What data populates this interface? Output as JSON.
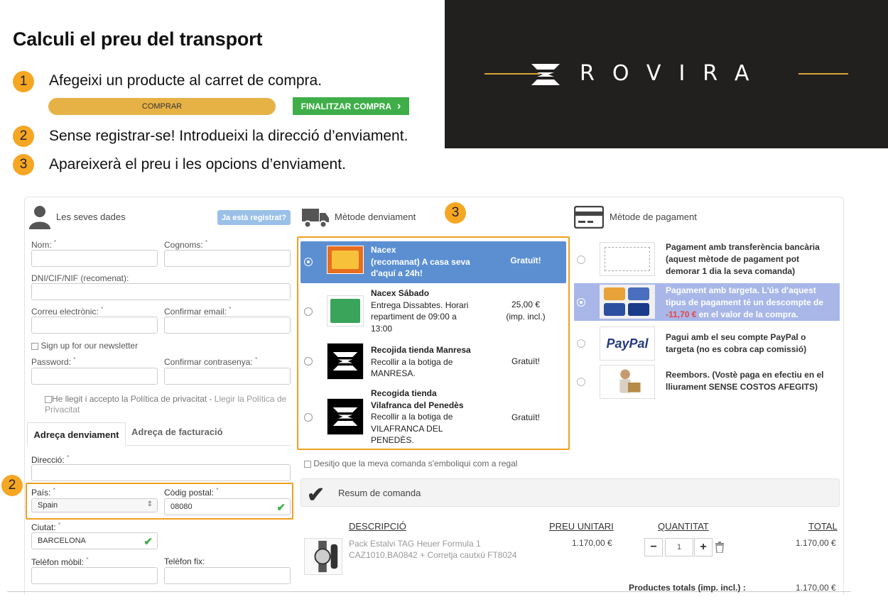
{
  "title": "Calculi el preu del transport",
  "steps": [
    {
      "num": "1",
      "text": "Afegeixi un producte al carret de compra."
    },
    {
      "num": "2",
      "text": "Sense registrar-se! Introdueixi la direcció d’enviament."
    },
    {
      "num": "3",
      "text": "Apareixerà el preu i les opcions d’enviament."
    }
  ],
  "buttons": {
    "comprar": "COMPRAR",
    "finalitzar": "FINALITZAR COMPRA",
    "finalitzar_icon": "›"
  },
  "brand": {
    "name": "ROVIRA",
    "accent_color": "#d7a534"
  },
  "annotations": {
    "box2": "2",
    "box3": "3"
  },
  "personal": {
    "header": "Les seves dades",
    "registered_button": "Ja està registrat?",
    "nom_label": "Nom:",
    "cognoms_label": "Cognoms:",
    "dni_label": "DNI/CIF/NIF (recomenat):",
    "email_label": "Correu electrònic:",
    "confirm_email_label": "Confirmar email:",
    "newsletter_label": "Sign up for our newsletter",
    "password_label": "Password:",
    "confirm_password_label": "Confirmar contrasenya:",
    "privacy_text": "He llegit i accepto la Política de privacitat - ",
    "privacy_link": "Llegir la Política de Privacitat",
    "required_mark": "*"
  },
  "address": {
    "tab_shipping": "Adreça denviament",
    "tab_billing": "Adreça de facturació",
    "direccio_label": "Direcció:",
    "pais_label": "País:",
    "pais_value": "Spain",
    "cp_label": "Còdig postal:",
    "cp_value": "08080",
    "ciutat_label": "Ciutat:",
    "ciutat_value": "BARCELONA",
    "mobil_label": "Telèfon mòbil:",
    "fix_label": "Telèfon fix:"
  },
  "shipping": {
    "header": "Mètode denviament",
    "options": [
      {
        "name": "Nacex",
        "desc": [
          "(recomanat) A casa seva",
          "d'aquí a 24h!"
        ],
        "price": [
          "Gratuït!"
        ],
        "selected": true,
        "logo": "nacex-logo"
      },
      {
        "name": "Nacex Sábado",
        "desc": [
          "Entrega Dissabtes. Horari",
          "repartiment de 09:00 a",
          "13:00"
        ],
        "price": [
          "25,00 €",
          "(imp. incl.)"
        ],
        "selected": false,
        "logo": "nacex-saturday-logo"
      },
      {
        "name": "Recojida tienda Manresa",
        "desc": [
          "Recollir a la botiga de",
          "MANRESA."
        ],
        "price": [
          "Gratuït!"
        ],
        "selected": false,
        "logo": "rovira-logo"
      },
      {
        "name": "Recogida tienda",
        "name2": "Vilafranca del Penedès",
        "desc": [
          "Recollir a la botiga de",
          "VILAFRANCA DEL",
          "PENEDÈS."
        ],
        "price": [
          "Gratuït!"
        ],
        "selected": false,
        "logo": "rovira-logo"
      }
    ],
    "gift_label": "Desitjo que la meva comanda s'emboliqui com a regal"
  },
  "payment": {
    "header": "Mètode de pagament",
    "options": [
      {
        "lines": [
          "Pagament amb transferència bancària",
          "(aquest mètode de pagament pot",
          "demorar 1 dia la seva comanda)"
        ],
        "selected": false,
        "icon": "bank-transfer-icon"
      },
      {
        "lines": [
          "Pagament amb targeta. L'ús d'aquest",
          "tipus de pagament té un descompte de"
        ],
        "discount": "-11,70 €",
        "tail": " en el valor de la compra.",
        "selected": true,
        "icon": "credit-cards-icon"
      },
      {
        "lines": [
          "Pagui amb el seu compte PayPal o",
          "targeta (no es cobra cap comissió)"
        ],
        "selected": false,
        "icon": "paypal-logo",
        "logo_text": "PayPal"
      },
      {
        "lines": [
          "Reembors. (Vostè paga en efectiu en el",
          "lliurament SENSE COSTOS AFEGITS)"
        ],
        "selected": false,
        "icon": "cash-on-delivery-icon"
      }
    ]
  },
  "summary": {
    "header": "Resum de comanda",
    "columns": [
      "DESCRIPCIÓ",
      "PREU UNITARI",
      "QUANTITAT",
      "TOTAL"
    ],
    "item": {
      "desc1": "Pack Estalvi TAG Heuer Formula 1",
      "desc2": "CAZ1010.BA0842 + Corretja cautxú FT8024",
      "unit_price": "1.170,00 €",
      "qty": "1",
      "total": "1.170,00 €"
    },
    "qty_minus": "−",
    "qty_plus": "+",
    "products_total_label": "Productes totals  (imp. incl.) :",
    "products_total_value": "1.170,00 €"
  },
  "colors": {
    "orange": "#f5a623",
    "green": "#3fae49",
    "selected_blue": "#5b8fd2",
    "selected_lilac": "#a8b7e8",
    "discount_red": "#e84545"
  }
}
